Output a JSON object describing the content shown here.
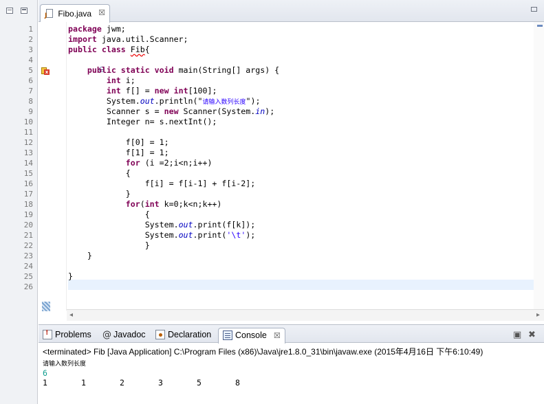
{
  "editor": {
    "tab_label": "Fibo.java",
    "close_glyph": "☒",
    "line_numbers": [
      "1",
      "2",
      "3",
      "4",
      "5",
      "6",
      "7",
      "8",
      "9",
      "10",
      "11",
      "12",
      "13",
      "14",
      "15",
      "16",
      "17",
      "18",
      "19",
      "20",
      "21",
      "22",
      "23",
      "24",
      "25",
      "26"
    ],
    "code": {
      "l1_kw": "package",
      "l1_rest": " jwm;",
      "l2_kw": "import",
      "l2_rest": " java.util.Scanner;",
      "l3_kw1": "public",
      "l3_kw2": "class",
      "l3_name": "Fib",
      "l3_rest": "{",
      "l5_kw1": "public",
      "l5_kw2": "static",
      "l5_kw3": "void",
      "l5_rest": " main(String[] args) {",
      "l6_kw": "int",
      "l6_rest": " i;",
      "l7_kw1": "int",
      "l7_mid": " f[] = ",
      "l7_kw2": "new",
      "l7_kw3": "int",
      "l7_rest": "[100];",
      "l8_pre": "System.",
      "l8_fld": "out",
      "l8_mid": ".println(\"",
      "l8_str": "请输入数列长度",
      "l8_end": "\");",
      "l9_pre": "Scanner s = ",
      "l9_kw": "new",
      "l9_mid": " Scanner(System.",
      "l9_fld": "in",
      "l9_end": ");",
      "l10": "Integer n= s.nextInt();",
      "l12": "f[0] = 1;",
      "l13": "f[1] = 1;",
      "l14_kw": "for",
      "l14_rest": " (i =2;i<n;i++)",
      "l15": "{",
      "l16": "f[i] = f[i-1] + f[i-2];",
      "l17": "}",
      "l18_kw1": "for",
      "l18_mid": "(",
      "l18_kw2": "int",
      "l18_rest": " k=0;k<n;k++)",
      "l19": "{",
      "l20_pre": "System.",
      "l20_fld": "out",
      "l20_end": ".print(f[k]);",
      "l21_pre": "System.",
      "l21_fld": "out",
      "l21_mid": ".print(",
      "l21_str": "'\\t'",
      "l21_end": ");",
      "l22": "}",
      "l23": "}",
      "l25": "}"
    }
  },
  "panel": {
    "tabs": {
      "problems": "Problems",
      "javadoc": "Javadoc",
      "declaration": "Declaration",
      "console": "Console"
    },
    "console_close": "☒",
    "controls": {
      "clear": "▣",
      "remove": "✖"
    }
  },
  "console": {
    "header": "<terminated> Fib [Java Application] C:\\Program Files (x86)\\Java\\jre1.8.0_31\\bin\\javaw.exe (2015年4月16日 下午6:10:49)",
    "prompt": "请输入数列长度",
    "input": "6",
    "results": [
      "1",
      "1",
      "2",
      "3",
      "5",
      "8"
    ]
  },
  "colors": {
    "keyword": "#7f0055",
    "string": "#2a00ff",
    "field": "#0000c0",
    "console_input": "#0f9d8f",
    "current_line": "#e8f2fe"
  }
}
